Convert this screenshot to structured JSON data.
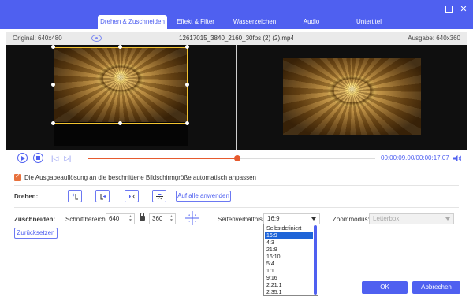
{
  "window": {
    "minimize_icon": "minimize-icon",
    "close_icon": "close-icon",
    "close_glyph": "✕"
  },
  "tabs": [
    {
      "label": "Drehen & Zuschneiden",
      "active": true
    },
    {
      "label": "Effekt & Filter",
      "active": false
    },
    {
      "label": "Wasserzeichen",
      "active": false
    },
    {
      "label": "Audio",
      "active": false
    },
    {
      "label": "Untertitel",
      "active": false
    }
  ],
  "infobar": {
    "original": "Original: 640x480",
    "filename": "12617015_3840_2160_30fps (2) (2).mp4",
    "output": "Ausgabe: 640x360"
  },
  "playback": {
    "timecode": "00:00:09.00/00:00:17.07",
    "progress": 0.52
  },
  "autofit_label": "Die Ausgabeauflösung an die beschnittene Bildschirmgröße automatisch anpassen",
  "rotate": {
    "label": "Drehen:",
    "apply_all": "Auf alle anwenden"
  },
  "crop": {
    "label": "Zuschneiden:",
    "area_label": "Schnittbereich:",
    "width": "640",
    "height": "360",
    "aspect_label": "Seitenverhältnis:",
    "aspect_value": "16:9",
    "zoom_label": "Zoommodus:",
    "zoom_value": "Letterbox",
    "reset": "Zurücksetzen"
  },
  "aspect_options": [
    "Selbstdefiniert",
    "16:9",
    "4:3",
    "21:9",
    "16:10",
    "5:4",
    "1:1",
    "9:16",
    "2.21:1",
    "2.35:1"
  ],
  "aspect_selected_index": 1,
  "buttons": {
    "ok": "OK",
    "cancel": "Abbrechen"
  },
  "colors": {
    "accent": "#4f60f0",
    "progress": "#e65a2e",
    "crop_frame": "#f2c230",
    "checkbox": "#e8713c"
  }
}
